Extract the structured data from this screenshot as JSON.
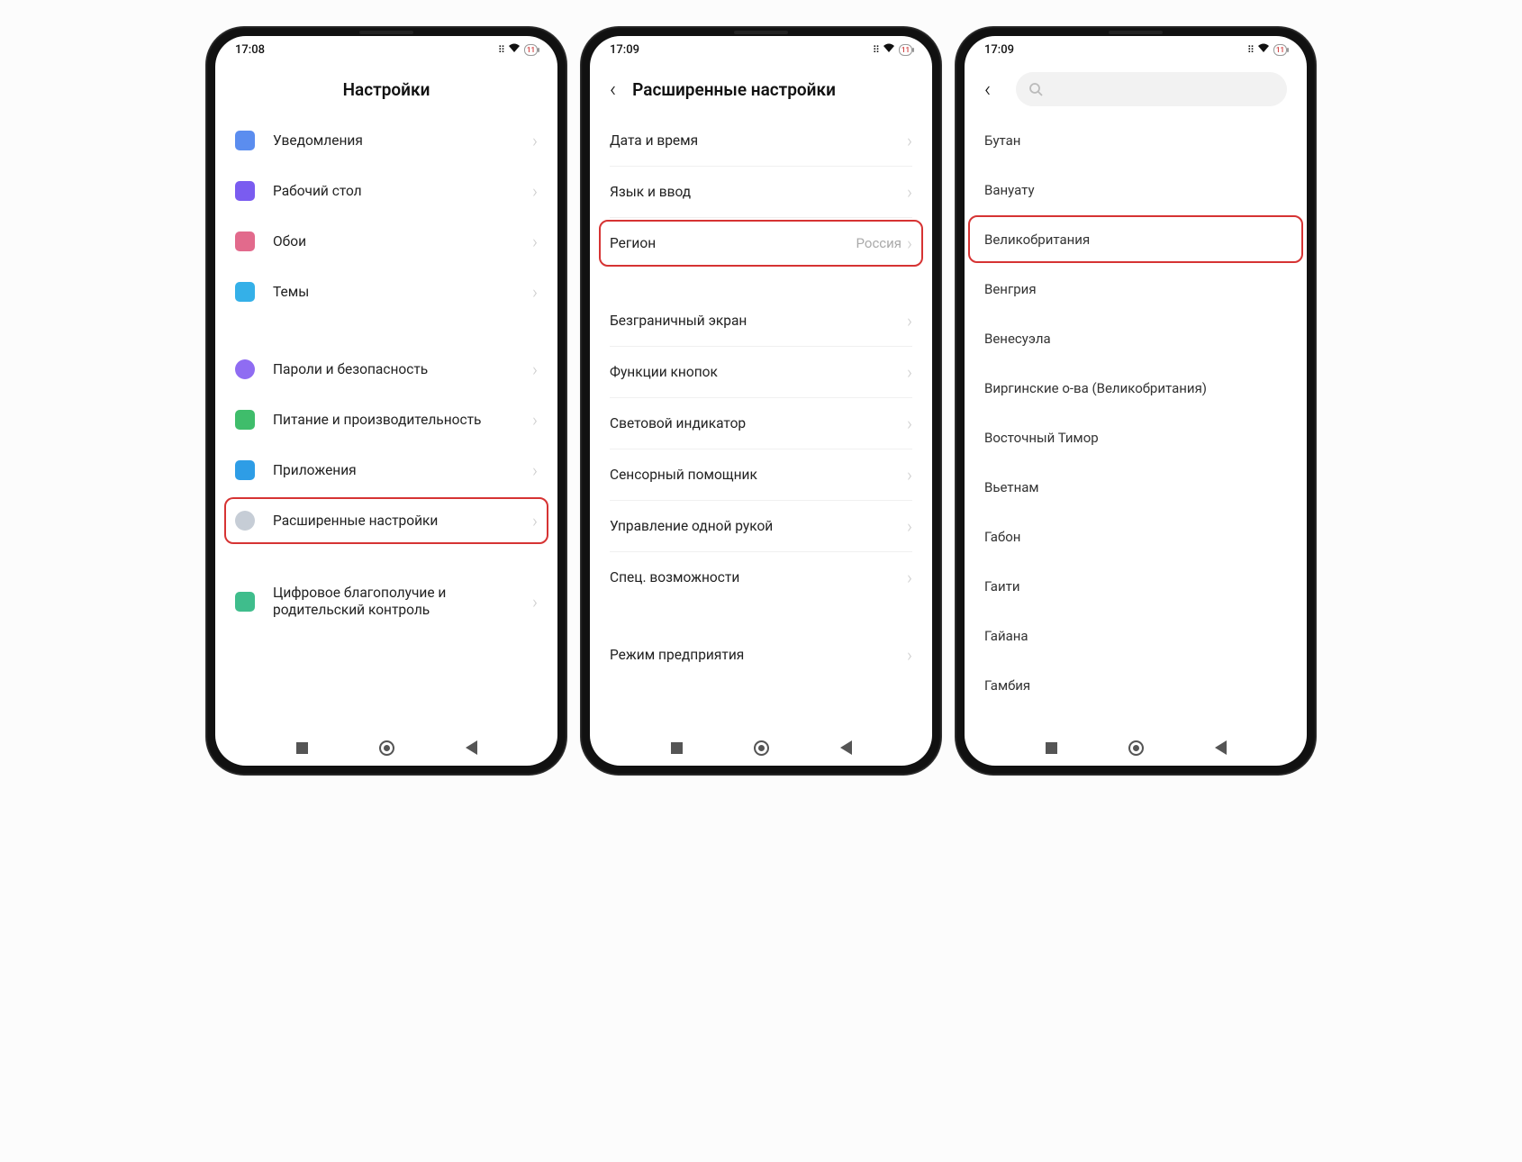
{
  "status": {
    "battery_text": "11"
  },
  "screens": [
    {
      "time": "17:08",
      "title": "Настройки",
      "groups": [
        {
          "items": [
            {
              "icon": "ic-bell",
              "label": "Уведомления"
            },
            {
              "icon": "ic-home",
              "label": "Рабочий стол"
            },
            {
              "icon": "ic-wall",
              "label": "Обои"
            },
            {
              "icon": "ic-theme",
              "label": "Темы"
            }
          ]
        },
        {
          "items": [
            {
              "icon": "ic-lock",
              "label": "Пароли и безопасность"
            },
            {
              "icon": "ic-batt",
              "label": "Питание и производительность"
            },
            {
              "icon": "ic-apps",
              "label": "Приложения"
            },
            {
              "icon": "ic-adv",
              "label": "Расширенные настройки",
              "highlight": true
            }
          ]
        },
        {
          "items": [
            {
              "icon": "ic-wb",
              "label": "Цифровое благополучие и родительский контроль",
              "multi": true
            }
          ]
        }
      ]
    },
    {
      "time": "17:09",
      "title": "Расширенные настройки",
      "groups": [
        {
          "items": [
            {
              "label": "Дата и время"
            },
            {
              "label": "Язык и ввод"
            },
            {
              "label": "Регион",
              "value": "Россия",
              "highlight": true
            }
          ]
        },
        {
          "items": [
            {
              "label": "Безграничный экран"
            },
            {
              "label": "Функции кнопок"
            },
            {
              "label": "Световой индикатор"
            },
            {
              "label": "Сенсорный помощник"
            },
            {
              "label": "Управление одной рукой"
            },
            {
              "label": "Спец. возможности"
            }
          ]
        },
        {
          "items": [
            {
              "label": "Режим предприятия"
            }
          ]
        }
      ]
    },
    {
      "time": "17:09",
      "regions": [
        {
          "label": "Бутан"
        },
        {
          "label": "Вануату"
        },
        {
          "label": "Великобритания",
          "highlight": true
        },
        {
          "label": "Венгрия"
        },
        {
          "label": "Венесуэла"
        },
        {
          "label": "Виргинские о-ва (Великобритания)"
        },
        {
          "label": "Восточный Тимор"
        },
        {
          "label": "Вьетнам"
        },
        {
          "label": "Габон"
        },
        {
          "label": "Гаити"
        },
        {
          "label": "Гайана"
        },
        {
          "label": "Гамбия"
        }
      ]
    }
  ]
}
